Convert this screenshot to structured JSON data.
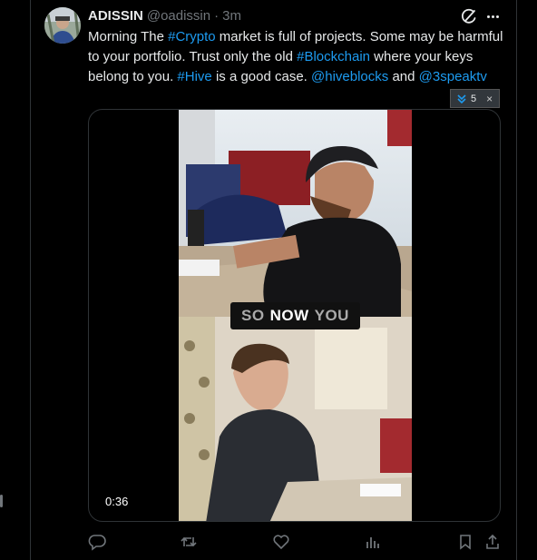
{
  "tweet": {
    "author_name": "ADISSIN",
    "handle": "@oadissin",
    "separator": "·",
    "timestamp": "3m",
    "text_segments": [
      {
        "text": "Morning The ",
        "link": false
      },
      {
        "text": "#Crypto",
        "link": true
      },
      {
        "text": " market is full of projects. Some may be harmful to your portfolio. Trust only the old ",
        "link": false
      },
      {
        "text": "#Blockchain",
        "link": true
      },
      {
        "text": " where your keys belong to you. ",
        "link": false
      },
      {
        "text": "#Hive",
        "link": true
      },
      {
        "text": " is a good case. ",
        "link": false
      },
      {
        "text": "@hiveblocks",
        "link": true
      },
      {
        "text": " and ",
        "link": false
      },
      {
        "text": "@3speaktv",
        "link": true
      }
    ]
  },
  "vote_widget": {
    "count": "5",
    "close": "×"
  },
  "video": {
    "caption_parts": [
      "SO",
      "NOW",
      "YOU"
    ],
    "duration": "0:36"
  },
  "icons": [
    "avatar",
    "grok-icon",
    "more-icon",
    "upvote-icon",
    "reply-icon",
    "retweet-icon",
    "like-icon",
    "views-icon",
    "bookmark-icon",
    "share-icon"
  ],
  "colors": {
    "link": "#1d9bf0",
    "muted": "#71767b",
    "background": "#000000"
  }
}
